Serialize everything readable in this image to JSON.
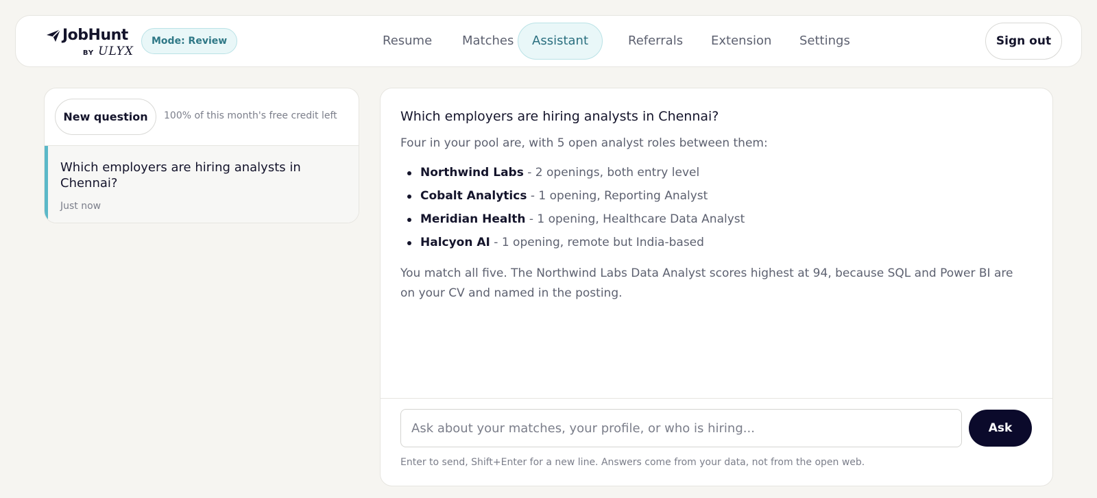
{
  "header": {
    "logo": {
      "wordmark": "JobHunt",
      "by": "BY",
      "brand": "ULYX"
    },
    "mode_pill": "Mode: Review",
    "nav": [
      {
        "label": "Resume",
        "active": false
      },
      {
        "label": "Matches",
        "active": false
      },
      {
        "label": "Assistant",
        "active": true
      },
      {
        "label": "Referrals",
        "active": false
      },
      {
        "label": "Extension",
        "active": false
      },
      {
        "label": "Settings",
        "active": false
      }
    ],
    "sign_out": "Sign out"
  },
  "sidebar": {
    "new_question": "New question",
    "credit_note": "100% of this month's free credit left",
    "history": [
      {
        "question": "Which employers are hiring analysts in Chennai?",
        "time": "Just now"
      }
    ]
  },
  "conversation": {
    "question": "Which employers are hiring analysts in Chennai?",
    "intro": "Four in your pool are, with 5 open analyst roles between them:",
    "employers": [
      {
        "name": "Northwind Labs",
        "detail": " - 2 openings, both entry level"
      },
      {
        "name": "Cobalt Analytics",
        "detail": " - 1 opening, Reporting Analyst"
      },
      {
        "name": "Meridian Health",
        "detail": " - 1 opening, Healthcare Data Analyst"
      },
      {
        "name": "Halcyon AI",
        "detail": " - 1 opening, remote but India-based"
      }
    ],
    "outro": "You match all five. The Northwind Labs Data Analyst scores highest at 94, because SQL and Power BI are on your CV and named in the posting."
  },
  "composer": {
    "placeholder": "Ask about your matches, your profile, or who is hiring...",
    "value": "",
    "ask_label": "Ask",
    "hint": "Enter to send, Shift+Enter for a new line. Answers come from your data, not from the open web."
  },
  "colors": {
    "background": "#f6f5f1",
    "accent_teal": "#5bb8c8",
    "active_tab_bg": "#e9f7f8",
    "primary_button": "#0b0a2b",
    "text_dark": "#14142b",
    "text_muted": "#5d6170"
  },
  "icons": {
    "logo": "paper-plane-icon"
  }
}
